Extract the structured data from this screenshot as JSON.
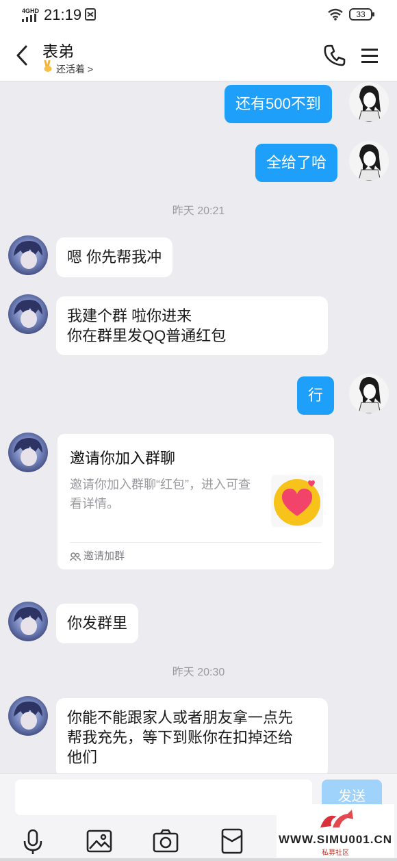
{
  "status_bar": {
    "network": "4GHD",
    "time": "21:19",
    "battery": "33"
  },
  "header": {
    "title": "表弟",
    "subtitle": "还活着 >",
    "back_icon": "chevron-left-icon",
    "call_icon": "phone-icon",
    "menu_icon": "menu-icon"
  },
  "messages": {
    "m1": "还有500不到",
    "m2": "全给了哈",
    "ts1": "昨天 20:21",
    "m3": "嗯 你先帮我冲",
    "m4_line1": "我建个群 啦你进来",
    "m4_line2": "你在群里发QQ普通红包",
    "m5": "行",
    "m7": "你发群里",
    "ts2": "昨天 20:30",
    "m8_line1": "你能不能跟家人或者朋友拿一点先",
    "m8_line2": "帮我充先，等下到账你在扣掉还给",
    "m8_line3": "他们"
  },
  "invite_card": {
    "title": "邀请你加入群聊",
    "description": "邀请你加入群聊“红包”，进入可查看详情。",
    "footer": "邀请加群"
  },
  "input_bar": {
    "placeholder": "",
    "send_label": "发送",
    "tools": [
      "microphone-icon",
      "photo-icon",
      "camera-icon",
      "red-packet-icon"
    ]
  },
  "watermark": {
    "text": "WWW.SIMU001.CN",
    "subtext": "私募社区"
  },
  "colors": {
    "accent": "#1ea0fa",
    "background": "#ececf0",
    "send_disabled": "#9fd3fb"
  }
}
